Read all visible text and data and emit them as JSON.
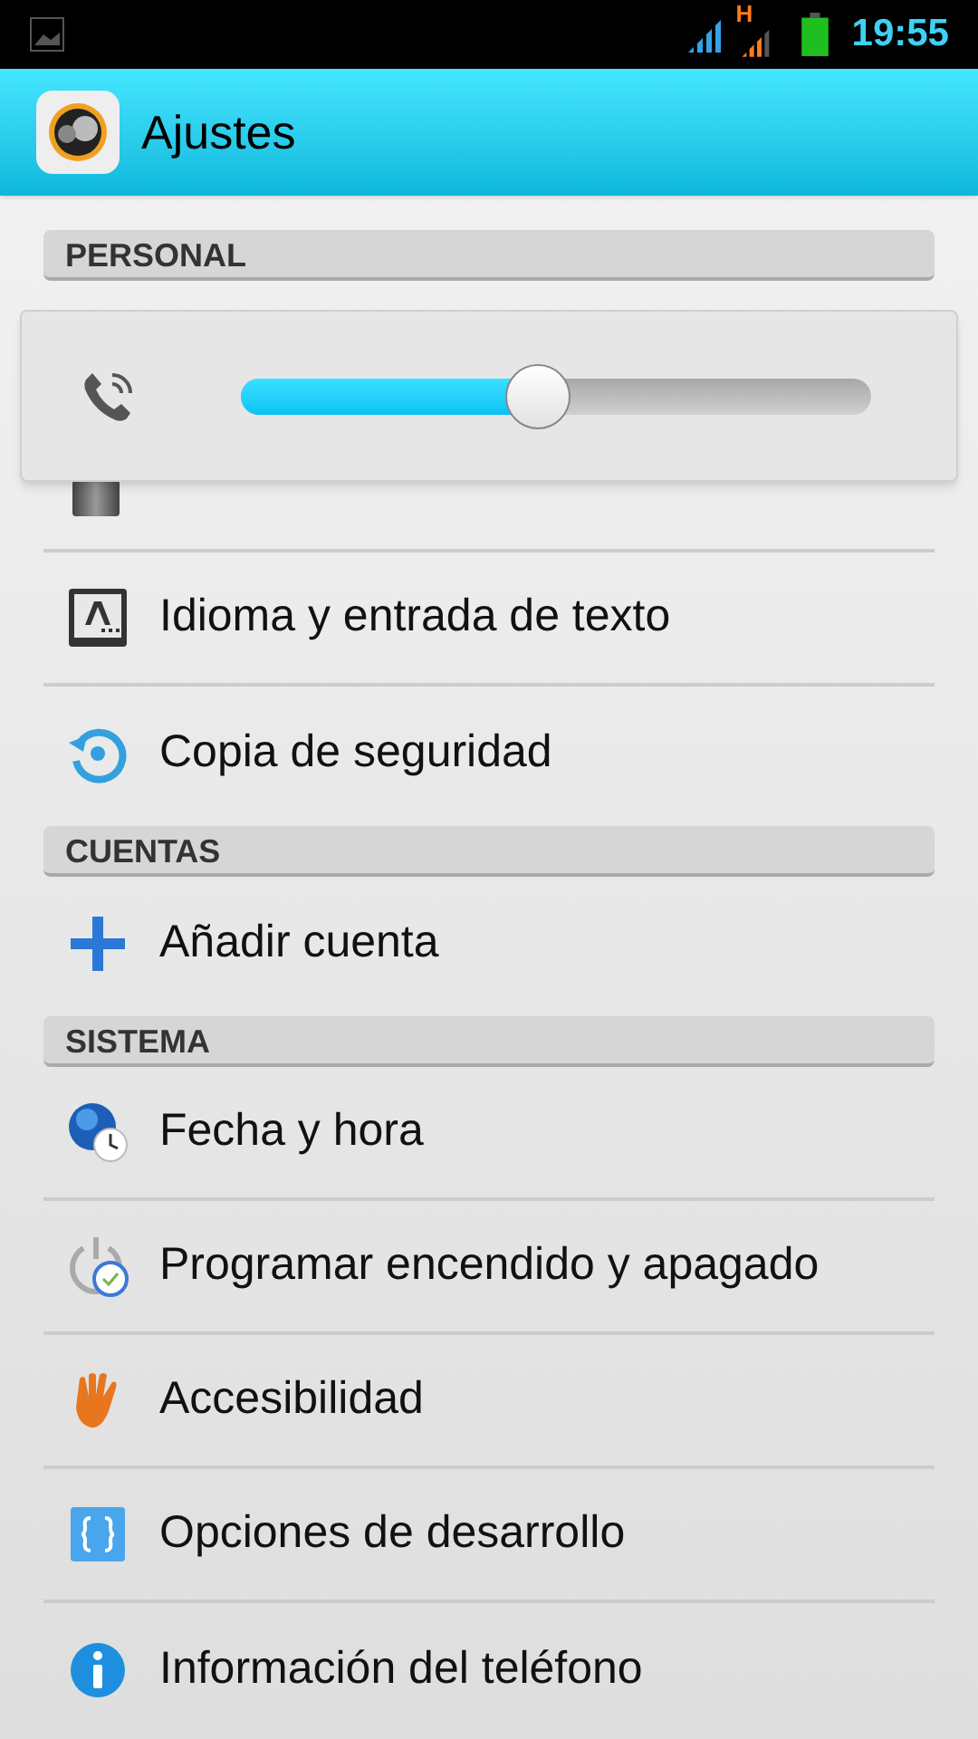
{
  "status_bar": {
    "network_label": "H",
    "time": "19:55"
  },
  "action_bar": {
    "title": "Ajustes"
  },
  "sections": [
    {
      "header": "PERSONAL",
      "items": [
        {
          "kind": "covered"
        },
        {
          "label": "Idioma y entrada de texto"
        },
        {
          "label": "Copia de seguridad"
        }
      ]
    },
    {
      "header": "CUENTAS",
      "items": [
        {
          "label": "Añadir cuenta"
        }
      ]
    },
    {
      "header": "SISTEMA",
      "items": [
        {
          "label": "Fecha y hora"
        },
        {
          "label": "Programar encendido y apagado"
        },
        {
          "label": "Accesibilidad"
        },
        {
          "label": "Opciones de desarrollo"
        },
        {
          "label": "Información del teléfono"
        }
      ]
    }
  ],
  "volume_popup": {
    "level": 0.47
  }
}
